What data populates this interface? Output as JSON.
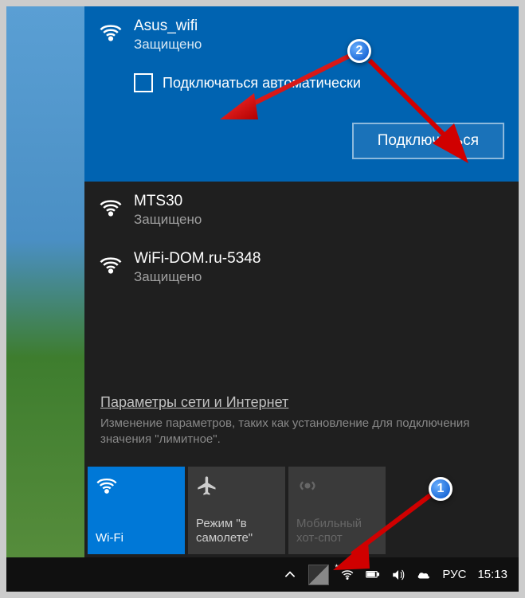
{
  "networks": [
    {
      "name": "Asus_wifi",
      "status": "Защищено",
      "selected": true,
      "auto_connect_label": "Подключаться автоматически",
      "connect_button": "Подключиться"
    },
    {
      "name": "MTS30",
      "status": "Защищено"
    },
    {
      "name": "WiFi-DOM.ru-5348",
      "status": "Защищено"
    }
  ],
  "settings": {
    "link": "Параметры сети и Интернет",
    "description": "Изменение параметров, таких как установление для подключения значения \"лимитное\"."
  },
  "tiles": {
    "wifi": "Wi-Fi",
    "airplane": "Режим \"в самолете\"",
    "hotspot": "Мобильный хот-спот"
  },
  "taskbar": {
    "lang": "РУС",
    "time": "15:13"
  },
  "callouts": {
    "one": "1",
    "two": "2"
  }
}
